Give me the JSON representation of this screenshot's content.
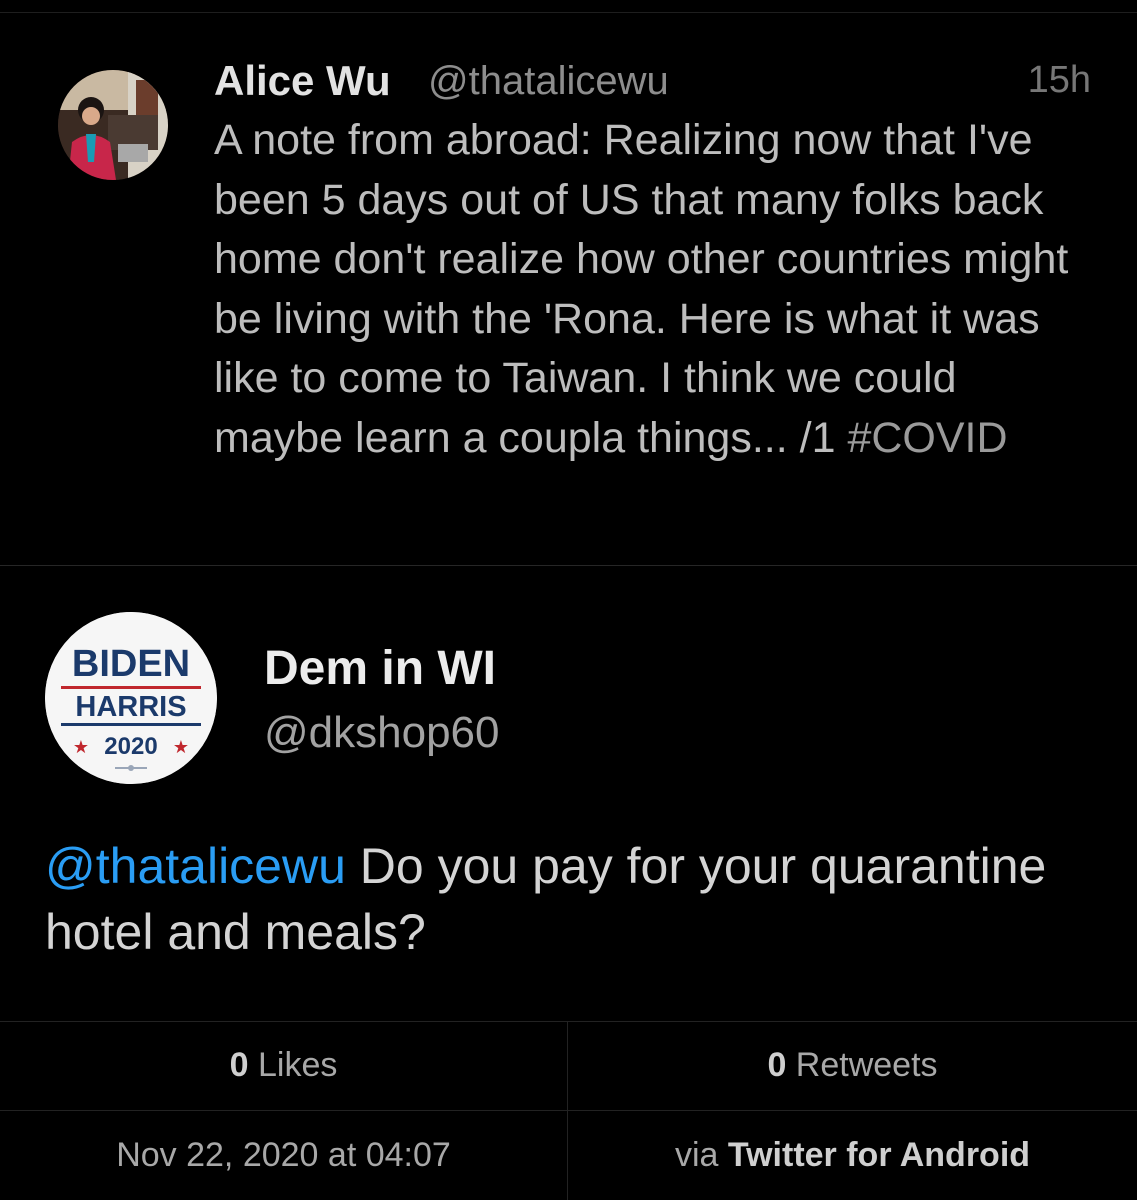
{
  "parent_tweet": {
    "author_name": "Alice Wu",
    "author_handle": "@thatalicewu",
    "time_ago": "15h",
    "text": "A note from abroad: Realizing now that I've been 5 days out of US that many folks back home don't realize how other countries might be living with the 'Rona. Here is what it was like to come to Taiwan. I think we could maybe learn a coupla things... /1 ",
    "hashtag": "#COVID"
  },
  "reply_tweet": {
    "author_name": "Dem in WI",
    "author_handle": "@dkshop60",
    "avatar_text": {
      "line1": "BIDEN",
      "line2": "HARRIS",
      "line3": "2020"
    },
    "mention": "@thatalicewu",
    "text": " Do you pay for your quarantine hotel and meals?"
  },
  "stats": {
    "likes_count": "0",
    "likes_label": " Likes",
    "retweets_count": "0",
    "retweets_label": " Retweets",
    "timestamp": "Nov 22, 2020 at 04:07",
    "via_prefix": "via ",
    "source": "Twitter for Android"
  },
  "colors": {
    "background": "#000000",
    "mention_blue": "#2a9df4",
    "avatar_red": "#c0272d",
    "avatar_navy": "#1b3a6b"
  }
}
